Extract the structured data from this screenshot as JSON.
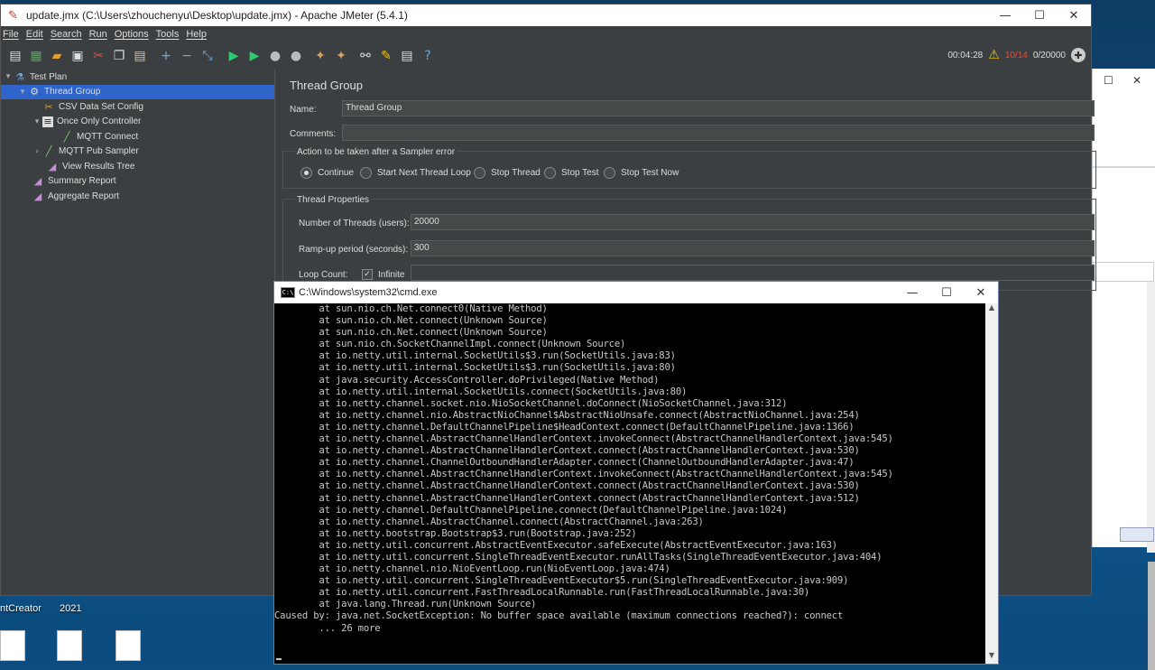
{
  "jmeter": {
    "window_title": "update.jmx (C:\\Users\\zhouchenyu\\Desktop\\update.jmx) - Apache JMeter (5.4.1)",
    "menu": [
      "File",
      "Edit",
      "Search",
      "Run",
      "Options",
      "Tools",
      "Help"
    ],
    "toolbar_status": {
      "elapsed": "00:04:28",
      "errors": "10/14",
      "threads": "0/20000"
    },
    "tree": [
      {
        "label": "Test Plan",
        "icon": "flask-icon",
        "level": 0,
        "arrow": "▾"
      },
      {
        "label": "Thread Group",
        "icon": "gear-icon",
        "level": 1,
        "arrow": "▾",
        "selected": true
      },
      {
        "label": "CSV Data Set Config",
        "icon": "scissors-icon",
        "level": 2,
        "arrow": ""
      },
      {
        "label": "Once Only Controller",
        "icon": "controller-icon",
        "level": 2,
        "arrow": "▾"
      },
      {
        "label": "MQTT Connect",
        "icon": "pipette-icon",
        "level": 3,
        "arrow": ""
      },
      {
        "label": "MQTT Pub Sampler",
        "icon": "pipette-icon",
        "level": 2,
        "arrow": "›"
      },
      {
        "label": "View Results Tree",
        "icon": "chart-icon",
        "level": 2,
        "arrow": ""
      },
      {
        "label": "Summary Report",
        "icon": "chart-icon",
        "level": 1,
        "arrow": ""
      },
      {
        "label": "Aggregate Report",
        "icon": "chart-icon",
        "level": 1,
        "arrow": ""
      }
    ],
    "panel": {
      "title": "Thread Group",
      "name_label": "Name:",
      "name_value": "Thread Group",
      "comments_label": "Comments:",
      "comments_value": "",
      "error_action_title": "Action to be taken after a Sampler error",
      "error_actions": [
        {
          "label": "Continue",
          "selected": true
        },
        {
          "label": "Start Next Thread Loop",
          "selected": false
        },
        {
          "label": "Stop Thread",
          "selected": false
        },
        {
          "label": "Stop Test",
          "selected": false
        },
        {
          "label": "Stop Test Now",
          "selected": false
        }
      ],
      "thread_props_title": "Thread Properties",
      "threads_label": "Number of Threads (users):",
      "threads_value": "20000",
      "rampup_label": "Ramp-up period (seconds):",
      "rampup_value": "300",
      "loop_label": "Loop Count:",
      "infinite_label": "Infinite",
      "infinite_checked": true
    }
  },
  "cmd": {
    "title": "C:\\Windows\\system32\\cmd.exe",
    "lines": [
      "        at sun.nio.ch.Net.connect0(Native Method)",
      "        at sun.nio.ch.Net.connect(Unknown Source)",
      "        at sun.nio.ch.Net.connect(Unknown Source)",
      "        at sun.nio.ch.SocketChannelImpl.connect(Unknown Source)",
      "        at io.netty.util.internal.SocketUtils$3.run(SocketUtils.java:83)",
      "        at io.netty.util.internal.SocketUtils$3.run(SocketUtils.java:80)",
      "        at java.security.AccessController.doPrivileged(Native Method)",
      "        at io.netty.util.internal.SocketUtils.connect(SocketUtils.java:80)",
      "        at io.netty.channel.socket.nio.NioSocketChannel.doConnect(NioSocketChannel.java:312)",
      "        at io.netty.channel.nio.AbstractNioChannel$AbstractNioUnsafe.connect(AbstractNioChannel.java:254)",
      "        at io.netty.channel.DefaultChannelPipeline$HeadContext.connect(DefaultChannelPipeline.java:1366)",
      "        at io.netty.channel.AbstractChannelHandlerContext.invokeConnect(AbstractChannelHandlerContext.java:545)",
      "        at io.netty.channel.AbstractChannelHandlerContext.connect(AbstractChannelHandlerContext.java:530)",
      "        at io.netty.channel.ChannelOutboundHandlerAdapter.connect(ChannelOutboundHandlerAdapter.java:47)",
      "        at io.netty.channel.AbstractChannelHandlerContext.invokeConnect(AbstractChannelHandlerContext.java:545)",
      "        at io.netty.channel.AbstractChannelHandlerContext.connect(AbstractChannelHandlerContext.java:530)",
      "        at io.netty.channel.AbstractChannelHandlerContext.connect(AbstractChannelHandlerContext.java:512)",
      "        at io.netty.channel.DefaultChannelPipeline.connect(DefaultChannelPipeline.java:1024)",
      "        at io.netty.channel.AbstractChannel.connect(AbstractChannel.java:263)",
      "        at io.netty.bootstrap.Bootstrap$3.run(Bootstrap.java:252)",
      "        at io.netty.util.concurrent.AbstractEventExecutor.safeExecute(AbstractEventExecutor.java:163)",
      "        at io.netty.util.concurrent.SingleThreadEventExecutor.runAllTasks(SingleThreadEventExecutor.java:404)",
      "        at io.netty.channel.nio.NioEventLoop.run(NioEventLoop.java:474)",
      "        at io.netty.util.concurrent.SingleThreadEventExecutor$5.run(SingleThreadEventExecutor.java:909)",
      "        at io.netty.util.concurrent.FastThreadLocalRunnable.run(FastThreadLocalRunnable.java:30)",
      "        at java.lang.Thread.run(Unknown Source)",
      "Caused by: java.net.SocketException: No buffer space available (maximum connections reached?): connect",
      "        ... 26 more"
    ]
  },
  "desktop": {
    "labels": [
      "ntCreator",
      "2021"
    ]
  }
}
